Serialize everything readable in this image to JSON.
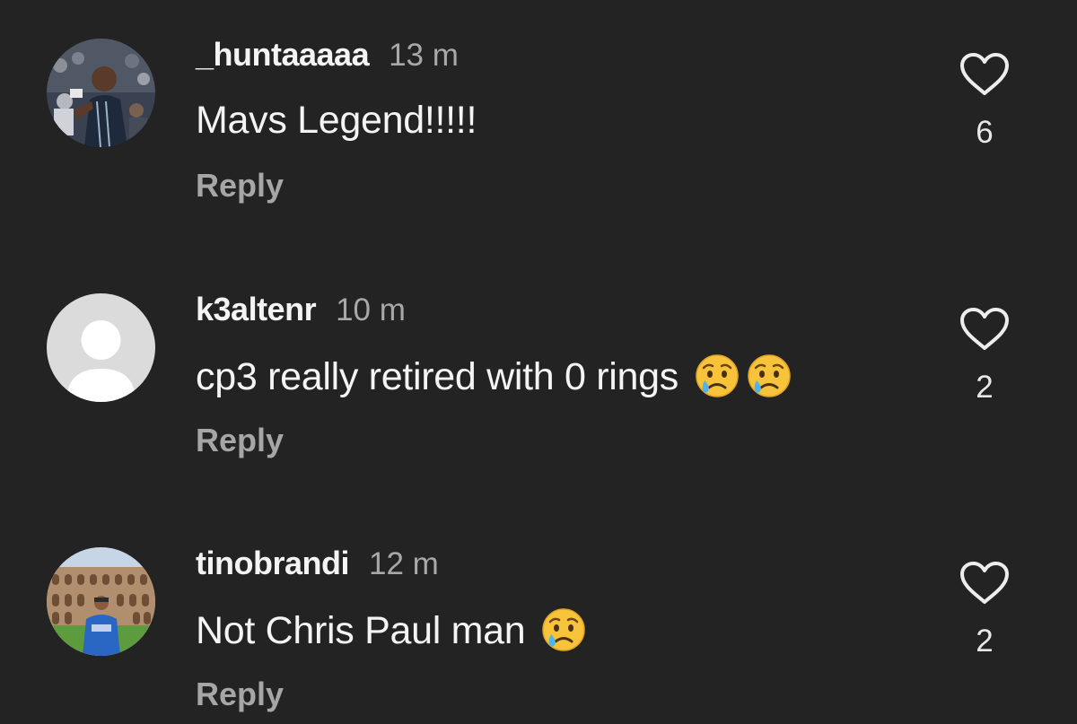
{
  "colors": {
    "background": "#232323",
    "username": "#f4f4f4",
    "secondary_text": "#a8a8a8",
    "heart_outline": "#ededed"
  },
  "comments": [
    {
      "username": "_huntaaaaa",
      "time": "13 m",
      "text": "Mavs Legend!!!!!",
      "emoji_count": 0,
      "reply_label": "Reply",
      "likes": "6",
      "avatar": "photo-basketball-player",
      "like_icon": "heart-outline-icon"
    },
    {
      "username": "k3altenr",
      "time": "10 m",
      "text": "cp3 really retired with 0 rings",
      "emoji_count": 2,
      "emoji": "crying-face-emoji",
      "reply_label": "Reply",
      "likes": "2",
      "avatar": "default-user-avatar",
      "like_icon": "heart-outline-icon"
    },
    {
      "username": "tinobrandi",
      "time": "12 m",
      "text": "Not Chris Paul man",
      "emoji_count": 1,
      "emoji": "crying-face-emoji",
      "reply_label": "Reply",
      "likes": "2",
      "avatar": "photo-person-at-colosseum",
      "like_icon": "heart-outline-icon"
    }
  ]
}
